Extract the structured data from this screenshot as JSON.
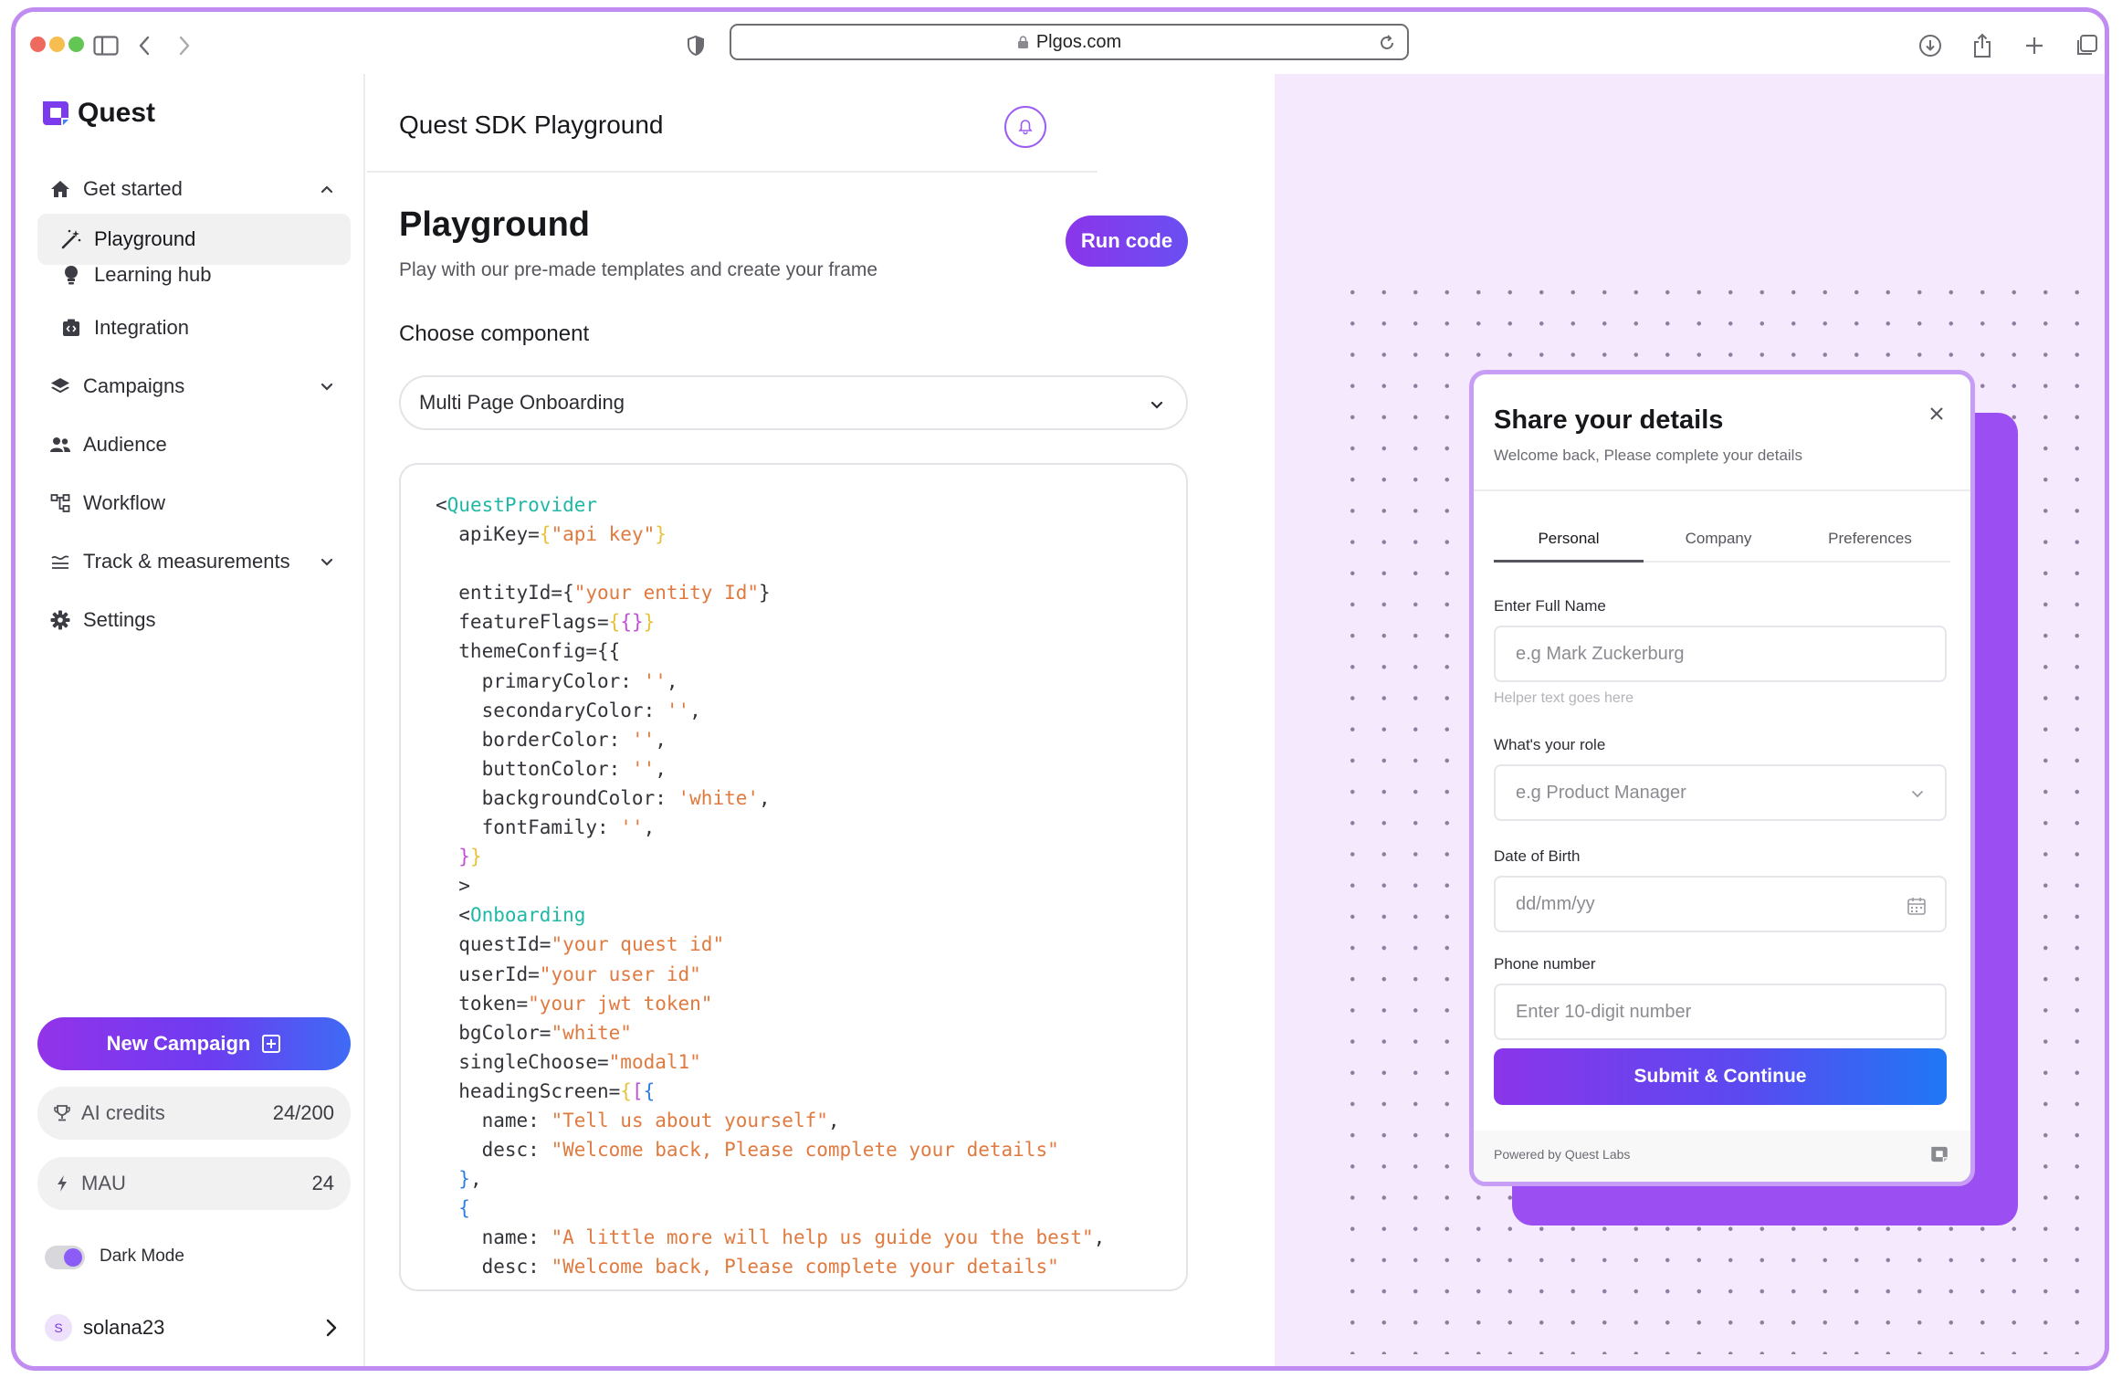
{
  "browser": {
    "url": "Plgos.com"
  },
  "sidebar": {
    "brand": "Quest",
    "nav": [
      {
        "label": "Get started"
      },
      {
        "label": "Playground"
      },
      {
        "label": "Learning hub"
      },
      {
        "label": "Integration"
      },
      {
        "label": "Campaigns"
      },
      {
        "label": "Audience"
      },
      {
        "label": "Workflow"
      },
      {
        "label": "Track & measurements"
      },
      {
        "label": "Settings"
      }
    ],
    "new_campaign": "New Campaign",
    "ai_credits_label": "AI credits",
    "ai_credits_value": "24/200",
    "mau_label": "MAU",
    "mau_value": "24",
    "dark_mode_label": "Dark Mode",
    "dark_mode_on": true,
    "user_initial": "S",
    "user_name": "solana23"
  },
  "main": {
    "header_title": "Quest SDK Playground",
    "heading": "Playground",
    "subtitle": "Play with our pre-made templates and create your frame",
    "run_button": "Run code",
    "choose_label": "Choose component",
    "component_selected": "Multi Page Onboarding"
  },
  "preview": {
    "title": "Share your details",
    "subtitle": "Welcome back, Please complete your details",
    "tabs": [
      "Personal",
      "Company",
      "Preferences"
    ],
    "active_tab": "Personal",
    "fields": [
      {
        "label": "Enter Full Name",
        "placeholder": "e.g Mark Zuckerburg"
      },
      {
        "label": "What's your role",
        "placeholder": "e.g Product Manager"
      },
      {
        "label": "Date of Birth",
        "placeholder": "dd/mm/yy"
      },
      {
        "label": "Phone number",
        "placeholder": "Enter 10-digit number"
      }
    ],
    "helper_text": "Helper text goes here",
    "submit": "Submit & Continue",
    "powered_by": "Powered by Quest Labs"
  },
  "colors": {
    "accent": "#8b35ea",
    "accent_blue": "#1f78f5",
    "preview_bg": "#f5e9fd",
    "frame_border": "#c08cf2"
  }
}
